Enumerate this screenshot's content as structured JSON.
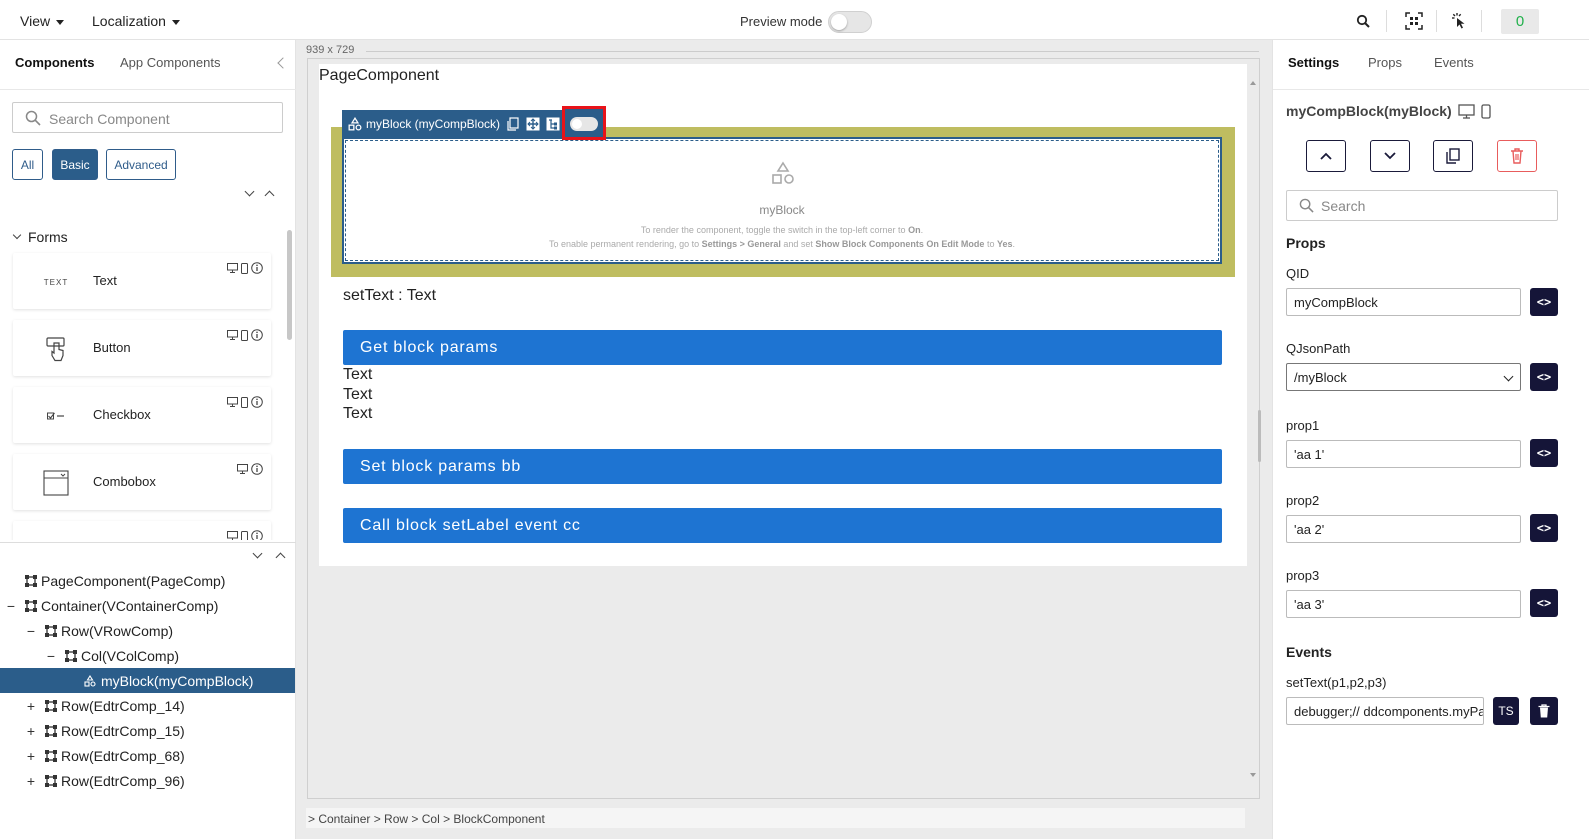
{
  "topbar": {
    "view_label": "View",
    "localization_label": "Localization",
    "preview_label": "Preview mode",
    "count_badge": "0",
    "badge_color": "#22b14c"
  },
  "left": {
    "tabs": [
      "Components",
      "App Components"
    ],
    "search_placeholder": "Search Component",
    "filters": [
      "All",
      "Basic",
      "Advanced"
    ],
    "active_filter": "Basic",
    "group_title": "Forms",
    "components": [
      {
        "label": "Text",
        "icon": "text-icon",
        "icon_text": "TEXT"
      },
      {
        "label": "Button",
        "icon": "button-icon"
      },
      {
        "label": "Checkbox",
        "icon": "checkbox-icon"
      },
      {
        "label": "Combobox",
        "icon": "combobox-icon"
      }
    ],
    "tree": [
      {
        "label": "PageComponent(PageComp)",
        "toggle": "",
        "level": 0
      },
      {
        "label": "Container(VContainerComp)",
        "toggle": "−",
        "level": 0
      },
      {
        "label": "Row(VRowComp)",
        "toggle": "−",
        "level": 1
      },
      {
        "label": "Col(VColComp)",
        "toggle": "−",
        "level": 2
      },
      {
        "label": "myBlock(myCompBlock)",
        "toggle": "",
        "level": 3,
        "selected": true
      },
      {
        "label": "Row(EdtrComp_14)",
        "toggle": "+",
        "level": 1
      },
      {
        "label": "Row(EdtrComp_15)",
        "toggle": "+",
        "level": 1
      },
      {
        "label": "Row(EdtrComp_68)",
        "toggle": "+",
        "level": 1
      },
      {
        "label": "Row(EdtrComp_96)",
        "toggle": "+",
        "level": 1
      }
    ]
  },
  "canvas": {
    "size_label": "939 x 729",
    "page_title": "PageComponent",
    "block_tag": "myBlock (myCompBlock)",
    "block_name": "myBlock",
    "hint_line1_a": "To render the component, toggle the switch in the top-left corner to ",
    "hint_line1_b": "On",
    "hint_line1_c": ".",
    "hint_line2_a": "To enable permanent rendering, go to ",
    "hint_line2_b": "Settings > General",
    "hint_line2_c": " and set ",
    "hint_line2_d": "Show Block Components On Edit Mode",
    "hint_line2_e": " to ",
    "hint_line2_f": "Yes",
    "hint_line2_g": ".",
    "set_text": "setText : Text",
    "buttons": [
      "Get block params",
      "Set block params bb",
      "Call block setLabel event cc"
    ],
    "text_lines": [
      "Text",
      "Text",
      "Text"
    ],
    "breadcrumb": "> Container > Row > Col > BlockComponent",
    "accent_color": "#1e74d2",
    "block_border_color": "#bfbd60",
    "highlight_color": "#e8131a"
  },
  "right": {
    "tabs": [
      "Settings",
      "Props",
      "Events"
    ],
    "title": "myCompBlock(myBlock)",
    "search_placeholder": "Search",
    "props_header": "Props",
    "fields": [
      {
        "label": "QID",
        "value": "myCompBlock",
        "type": "text"
      },
      {
        "label": "QJsonPath",
        "value": "/myBlock",
        "type": "select"
      },
      {
        "label": "prop1",
        "value": "'aa 1'",
        "type": "text"
      },
      {
        "label": "prop2",
        "value": "'aa 2'",
        "type": "text"
      },
      {
        "label": "prop3",
        "value": "'aa 3'",
        "type": "text"
      }
    ],
    "code_button": "<>",
    "events_header": "Events",
    "event_label": "setText(p1,p2,p3)",
    "event_value": "debugger;// ddcomponents.myPa",
    "ts_label": "TS"
  }
}
